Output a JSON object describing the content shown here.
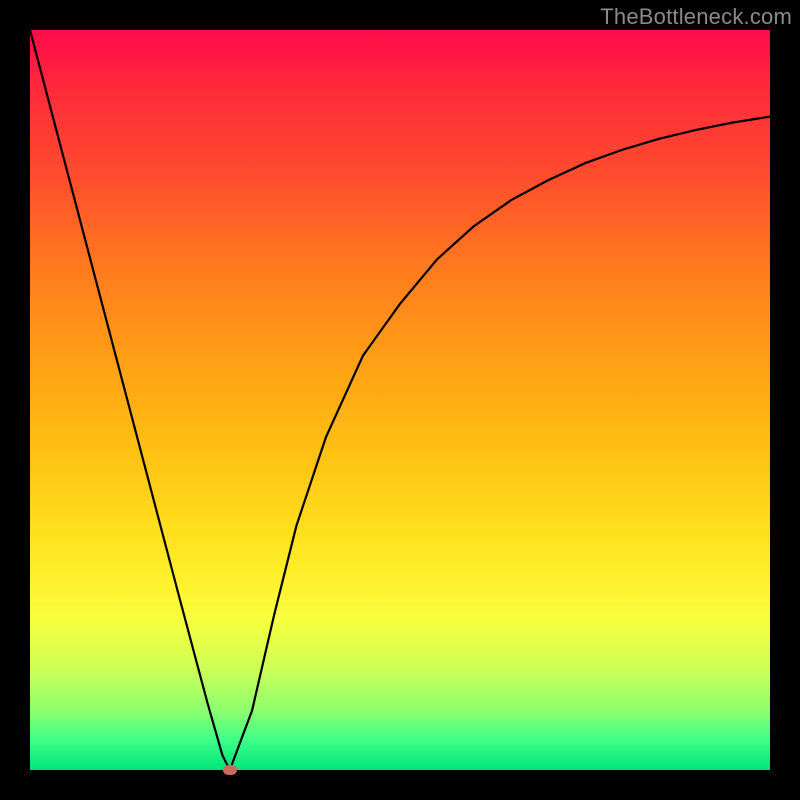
{
  "watermark": "TheBottleneck.com",
  "colors": {
    "frame": "#000000",
    "curve": "#000000",
    "marker": "#c96a5f",
    "gradient_top": "#ff0a4a",
    "gradient_bottom": "#00e47a"
  },
  "chart_data": {
    "type": "line",
    "title": "",
    "xlabel": "",
    "ylabel": "",
    "xlim": [
      0,
      100
    ],
    "ylim": [
      0,
      100
    ],
    "grid": false,
    "legend": false,
    "series": [
      {
        "name": "curve",
        "x": [
          0,
          5,
          10,
          15,
          20,
          24,
          26,
          27,
          30,
          33,
          36,
          40,
          45,
          50,
          55,
          60,
          65,
          70,
          75,
          80,
          85,
          90,
          95,
          100
        ],
        "y": [
          100,
          81,
          62,
          43,
          24,
          9,
          2,
          0,
          8,
          21,
          33,
          45,
          56,
          63,
          69,
          73.5,
          77,
          79.7,
          82,
          83.8,
          85.3,
          86.5,
          87.5,
          88.3
        ]
      }
    ],
    "marker": {
      "x": 27,
      "y": 0
    }
  }
}
